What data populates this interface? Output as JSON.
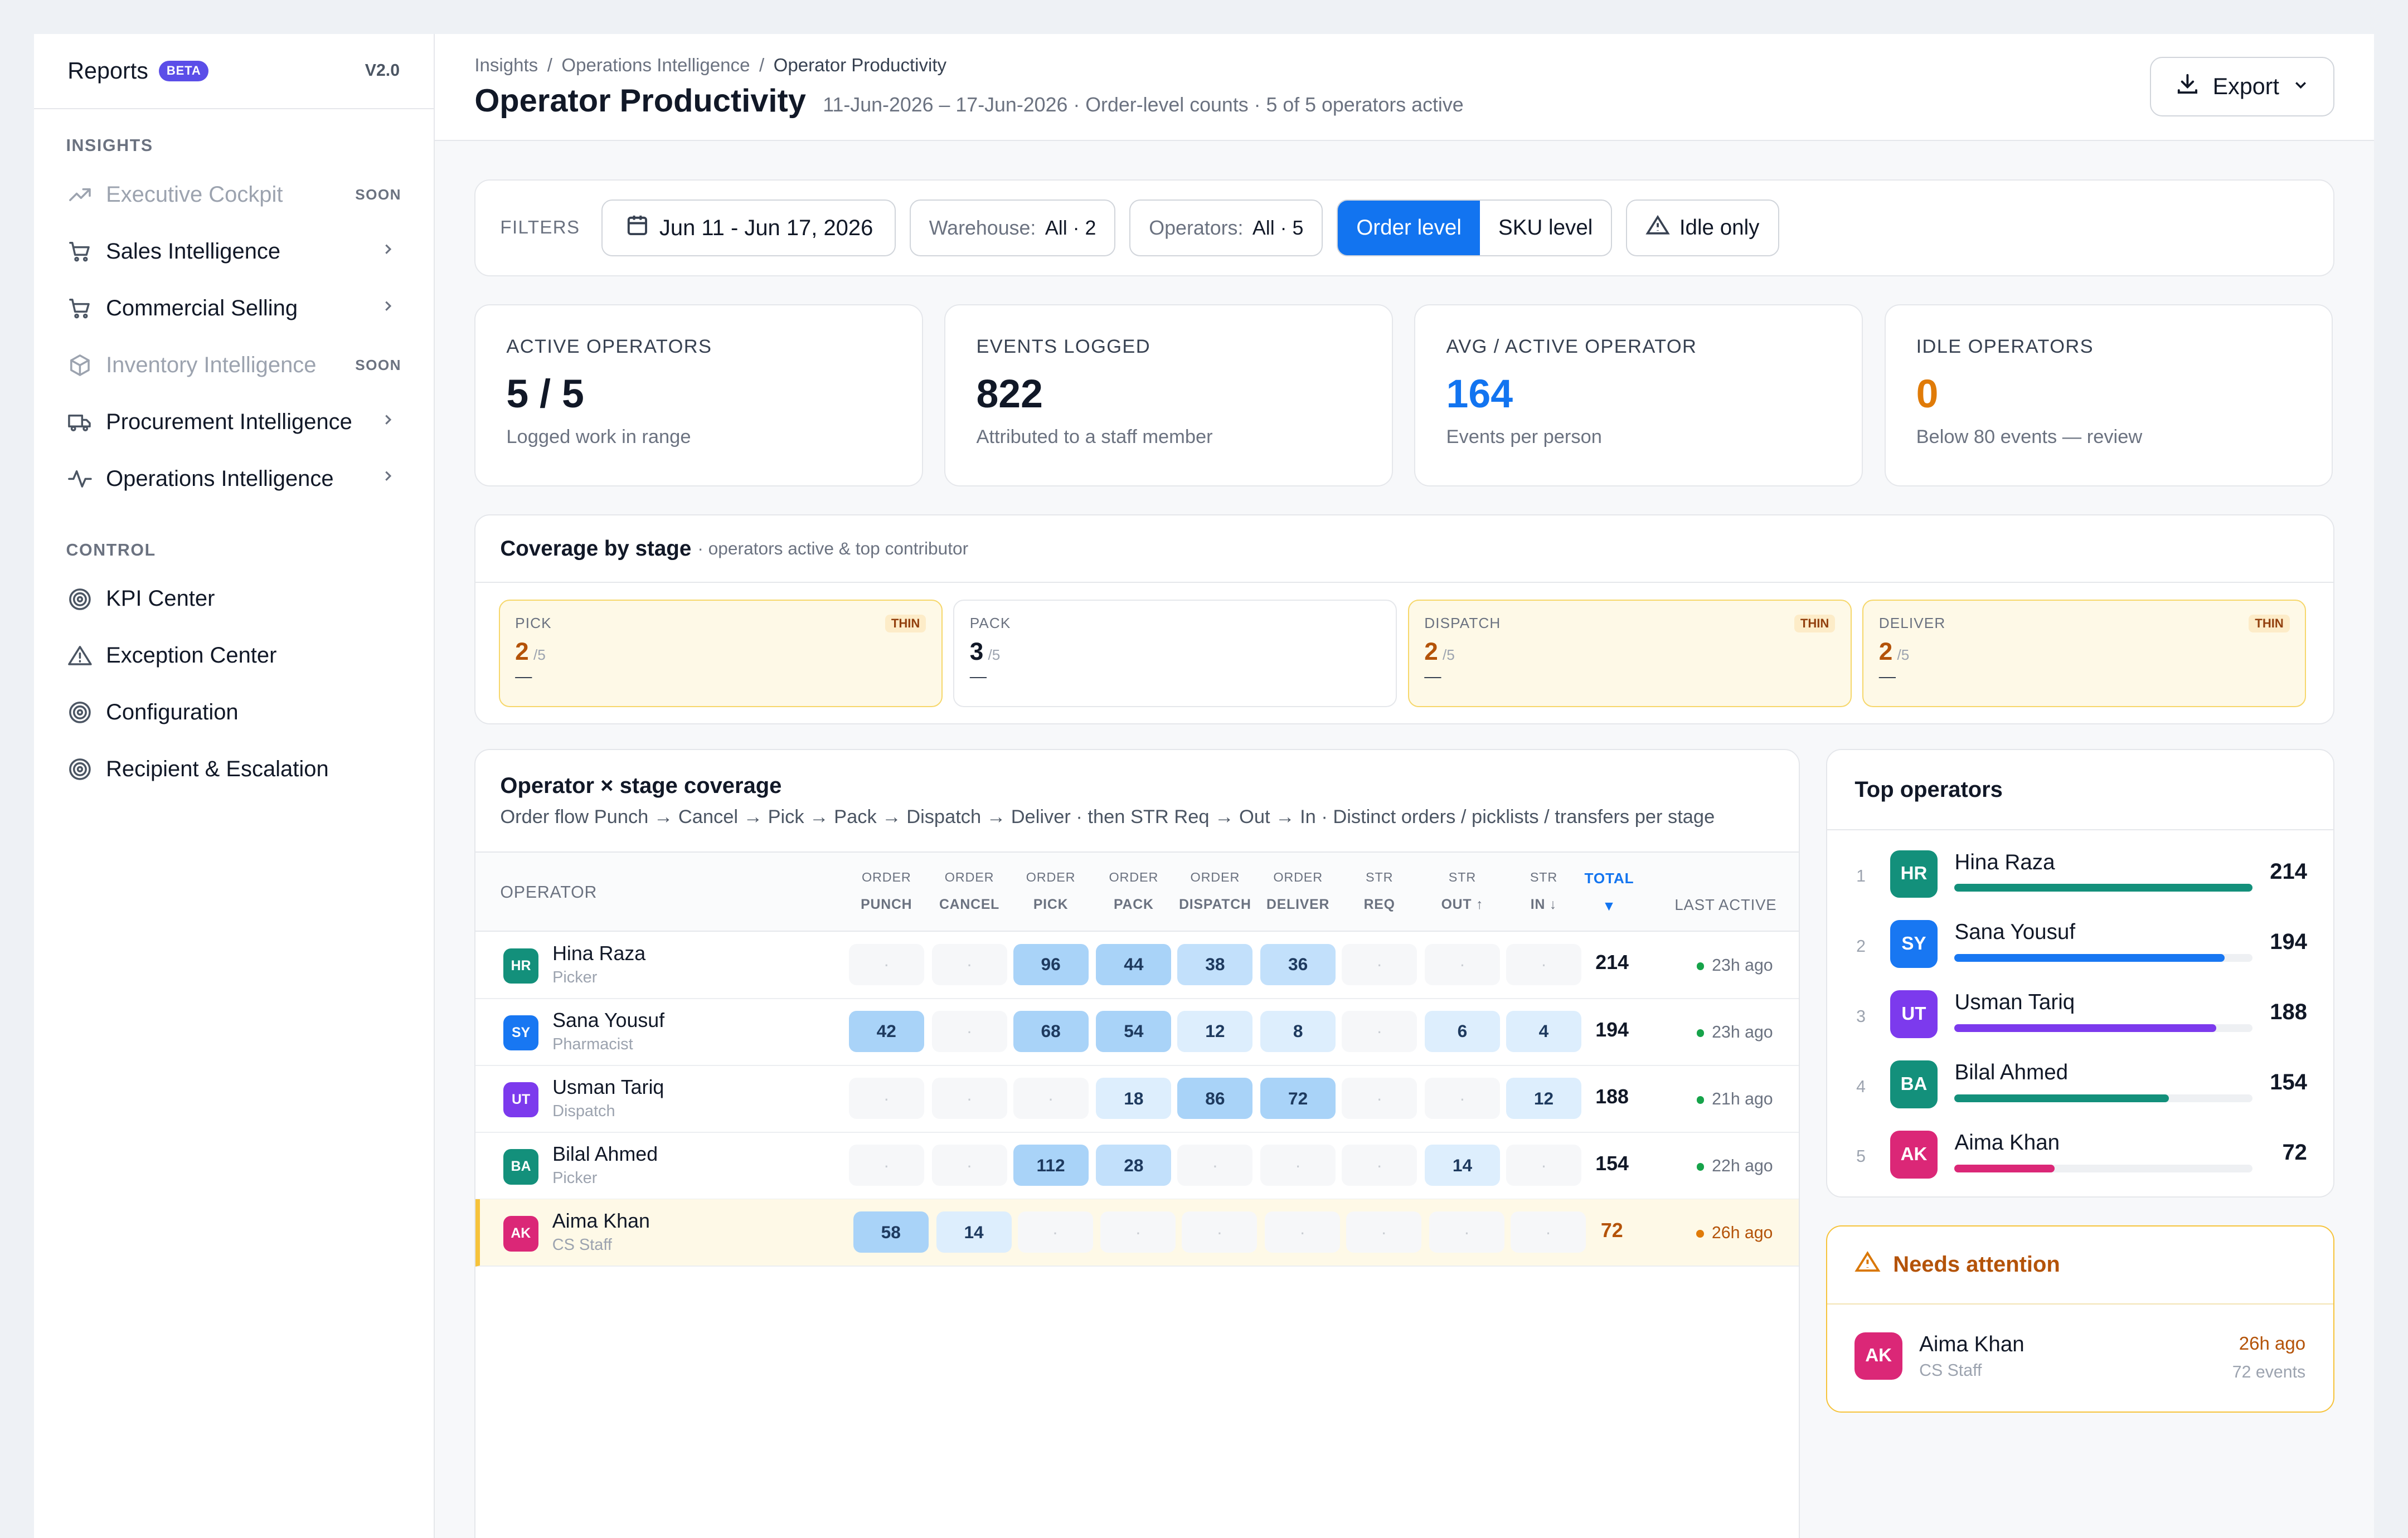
{
  "sidebar": {
    "title": "Reports",
    "badge": "BETA",
    "version": "V2.0",
    "insights_label": "INSIGHTS",
    "control_label": "CONTROL",
    "insights": [
      {
        "label": "Executive Cockpit",
        "icon": "trend-icon",
        "tag": "SOON",
        "dim": true
      },
      {
        "label": "Sales Intelligence",
        "icon": "cart-icon",
        "chevron": true
      },
      {
        "label": "Commercial Selling",
        "icon": "cart-icon",
        "chevron": true
      },
      {
        "label": "Inventory Intelligence",
        "icon": "box-icon",
        "tag": "SOON",
        "dim": true
      },
      {
        "label": "Procurement Intelligence",
        "icon": "truck-icon",
        "chevron": true
      },
      {
        "label": "Operations Intelligence",
        "icon": "pulse-icon",
        "chevron": true
      }
    ],
    "control": [
      {
        "label": "KPI Center",
        "icon": "target-icon"
      },
      {
        "label": "Exception Center",
        "icon": "warning-icon"
      },
      {
        "label": "Configuration",
        "icon": "target-icon"
      },
      {
        "label": "Recipient & Escalation",
        "icon": "target-icon"
      }
    ]
  },
  "header": {
    "crumbs": [
      "Insights",
      "/",
      "Operations Intelligence",
      "/",
      "Operator Productivity"
    ],
    "title": "Operator Productivity",
    "subtitle": "11-Jun-2026 – 17-Jun-2026 · Order-level counts · 5 of 5 operators active",
    "export": "Export"
  },
  "filters": {
    "label": "FILTERS",
    "date": "Jun 11 - Jun 17, 2026",
    "warehouse_key": "Warehouse:",
    "warehouse_val": "All · 2",
    "operators_key": "Operators:",
    "operators_val": "All · 5",
    "seg_order": "Order level",
    "seg_sku": "SKU level",
    "idle": "Idle only"
  },
  "kpis": [
    {
      "label": "ACTIVE OPERATORS",
      "value": "5 / 5",
      "sub": "Logged work in range",
      "color": "#111827"
    },
    {
      "label": "EVENTS LOGGED",
      "value": "822",
      "sub": "Attributed to a staff member",
      "color": "#111827"
    },
    {
      "label": "AVG / ACTIVE OPERATOR",
      "value": "164",
      "sub": "Events per person",
      "color": "#1274f0"
    },
    {
      "label": "IDLE OPERATORS",
      "value": "0",
      "sub": "Below 80 events — review",
      "color": "#e07b08"
    }
  ],
  "coverage": {
    "title": "Coverage by stage",
    "sub": "· operators active & top contributor",
    "stages": [
      {
        "label": "PICK",
        "value": "2",
        "of": "/5",
        "dash": "—",
        "thin": "THIN"
      },
      {
        "label": "PACK",
        "value": "3",
        "of": "/5",
        "dash": "—",
        "thin": ""
      },
      {
        "label": "DISPATCH",
        "value": "2",
        "of": "/5",
        "dash": "—",
        "thin": "THIN"
      },
      {
        "label": "DELIVER",
        "value": "2",
        "of": "/5",
        "dash": "—",
        "thin": "THIN"
      }
    ]
  },
  "matrix": {
    "title": "Operator × stage coverage",
    "sub": "Order flow Punch → Cancel → Pick → Pack → Dispatch → Deliver · then STR Req → Out → In · Distinct orders / picklists / transfers per stage",
    "col_operator": "OPERATOR",
    "col_total": "TOTAL",
    "col_last": "LAST ACTIVE",
    "sort_arrow": "▼",
    "cols": [
      [
        "ORDER",
        "PUNCH"
      ],
      [
        "ORDER",
        "CANCEL"
      ],
      [
        "ORDER",
        "PICK"
      ],
      [
        "ORDER",
        "PACK"
      ],
      [
        "ORDER",
        "DISPATCH"
      ],
      [
        "ORDER",
        "DELIVER"
      ],
      [
        "STR",
        "REQ"
      ],
      [
        "STR",
        "OUT ↑"
      ],
      [
        "STR",
        "IN ↓"
      ]
    ],
    "rows": [
      {
        "initials": "HR",
        "name": "Hina Raza",
        "role": "Picker",
        "color": "#13907b",
        "cells": [
          null,
          null,
          96,
          44,
          38,
          36,
          null,
          null,
          null
        ],
        "total": "214",
        "last": "23h ago",
        "warn": false
      },
      {
        "initials": "SY",
        "name": "Sana Yousuf",
        "role": "Pharmacist",
        "color": "#1877f2",
        "cells": [
          42,
          null,
          68,
          54,
          12,
          8,
          null,
          6,
          4
        ],
        "total": "194",
        "last": "23h ago",
        "warn": false
      },
      {
        "initials": "UT",
        "name": "Usman Tariq",
        "role": "Dispatch",
        "color": "#7c3aed",
        "cells": [
          null,
          null,
          null,
          18,
          86,
          72,
          null,
          null,
          12
        ],
        "total": "188",
        "last": "21h ago",
        "warn": false
      },
      {
        "initials": "BA",
        "name": "Bilal Ahmed",
        "role": "Picker",
        "color": "#13907b",
        "cells": [
          null,
          null,
          112,
          28,
          null,
          null,
          null,
          14,
          null
        ],
        "total": "154",
        "last": "22h ago",
        "warn": false
      },
      {
        "initials": "AK",
        "name": "Aima Khan",
        "role": "CS Staff",
        "color": "#db2777",
        "cells": [
          58,
          14,
          null,
          null,
          null,
          null,
          null,
          null,
          null
        ],
        "total": "72",
        "last": "26h ago",
        "warn": true
      }
    ],
    "empty": "·"
  },
  "top": {
    "title": "Top operators",
    "items": [
      {
        "rank": "1",
        "initials": "HR",
        "name": "Hina Raza",
        "value": "214",
        "color": "#13907b",
        "fraction": 1.0
      },
      {
        "rank": "2",
        "initials": "SY",
        "name": "Sana Yousuf",
        "value": "194",
        "color": "#1877f2",
        "fraction": 0.906
      },
      {
        "rank": "3",
        "initials": "UT",
        "name": "Usman Tariq",
        "value": "188",
        "color": "#7c3aed",
        "fraction": 0.878
      },
      {
        "rank": "4",
        "initials": "BA",
        "name": "Bilal Ahmed",
        "value": "154",
        "color": "#13907b",
        "fraction": 0.72
      },
      {
        "rank": "5",
        "initials": "AK",
        "name": "Aima Khan",
        "value": "72",
        "color": "#db2777",
        "fraction": 0.336
      }
    ]
  },
  "attention": {
    "title": "Needs attention",
    "initials": "AK",
    "name": "Aima Khan",
    "role": "CS Staff",
    "when": "26h ago",
    "events": "72 events"
  }
}
